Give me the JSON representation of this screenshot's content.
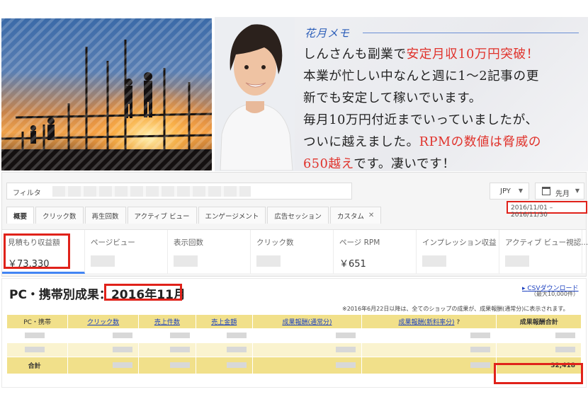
{
  "memo": {
    "title": "花月メモ",
    "lines": [
      {
        "parts": [
          {
            "t": "しんさんも副業で",
            "red": false
          },
          {
            "t": "安定月収10万円突破！",
            "red": true
          }
        ]
      },
      {
        "parts": [
          {
            "t": "本業が忙しい中なんと週に1〜2記事の更",
            "red": false
          }
        ]
      },
      {
        "parts": [
          {
            "t": "新でも安定して稼いでいます。",
            "red": false
          }
        ]
      },
      {
        "parts": [
          {
            "t": "毎月10万円付近までいっていましたが、",
            "red": false
          }
        ]
      },
      {
        "parts": [
          {
            "t": "ついに越えました。",
            "red": false
          },
          {
            "t": "RPMの数値は脅威の",
            "red": true
          }
        ]
      },
      {
        "parts": [
          {
            "t": "650越え",
            "red": true
          },
          {
            "t": "です。凄いです！",
            "red": false
          }
        ]
      }
    ]
  },
  "analytics": {
    "filter_label": "フィルタ",
    "currency": "JPY",
    "period": "先月",
    "date_range": "2016/11/01 – 2016/11/30",
    "tabs": [
      {
        "label": "概要",
        "active": true,
        "closable": false
      },
      {
        "label": "クリック数",
        "active": false,
        "closable": false
      },
      {
        "label": "再生回数",
        "active": false,
        "closable": false
      },
      {
        "label": "アクティブ ビュー",
        "active": false,
        "closable": false
      },
      {
        "label": "エンゲージメント",
        "active": false,
        "closable": false
      },
      {
        "label": "広告セッション",
        "active": false,
        "closable": false
      },
      {
        "label": "カスタム",
        "active": false,
        "closable": true
      }
    ],
    "metrics": [
      {
        "label": "見積もり収益額",
        "value": "￥73,330"
      },
      {
        "label": "ページビュー",
        "value": ""
      },
      {
        "label": "表示回数",
        "value": ""
      },
      {
        "label": "クリック数",
        "value": ""
      },
      {
        "label": "ページ RPM",
        "value": "￥651"
      },
      {
        "label": "インプレッション収益",
        "value": ""
      },
      {
        "label": "アクティブ ビュー視認...",
        "value": ""
      }
    ]
  },
  "affiliate": {
    "title_prefix": "PC・携帯別成果：",
    "month": "2016年11月",
    "csv_link": "CSVダウンロード",
    "csv_sub": "（最大10,000件）",
    "note": "※2016年6月22日以降は、全てのショップの成果が、成果報酬(通常分)に表示されます。",
    "headers": [
      "PC・携帯",
      "クリック数",
      "売上件数",
      "売上金額",
      "成果報酬(通常分)",
      "成果報酬(新料率分)",
      "成果報酬合計"
    ],
    "rows": [
      {
        "label": "",
        "cells": [
          "",
          "",
          "",
          "",
          "",
          ""
        ]
      },
      {
        "label": "",
        "cells": [
          "",
          "",
          "",
          "",
          "",
          ""
        ]
      }
    ],
    "total_label": "合計",
    "total_value": "32,418"
  }
}
